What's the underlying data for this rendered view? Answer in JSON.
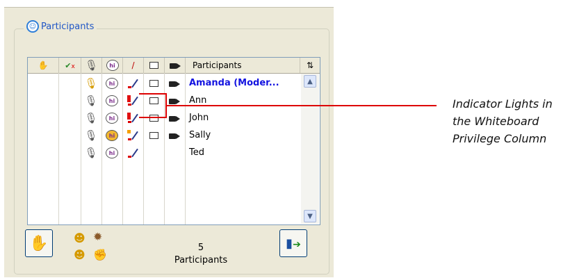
{
  "panel": {
    "title": "Participants"
  },
  "columns": [
    {
      "icon": "raise-hand-icon"
    },
    {
      "icon": "check-x-icon"
    },
    {
      "icon": "microphone-icon"
    },
    {
      "icon": "chat-bubble-icon"
    },
    {
      "icon": "whiteboard-pen-icon"
    },
    {
      "icon": "screen-share-icon"
    },
    {
      "icon": "video-camera-icon"
    },
    {
      "label": "Participants"
    },
    {
      "icon": "sort-icon",
      "glyph": "⇅"
    }
  ],
  "participants": [
    {
      "name": "Amanda (Moder...",
      "moderator": true,
      "mic_active": true,
      "chat_active": false,
      "light": "",
      "video": true
    },
    {
      "name": "Ann",
      "moderator": false,
      "mic_active": false,
      "chat_active": false,
      "light": "red",
      "video": true
    },
    {
      "name": "John",
      "moderator": false,
      "mic_active": false,
      "chat_active": false,
      "light": "red",
      "video": true
    },
    {
      "name": "Sally",
      "moderator": false,
      "mic_active": false,
      "chat_active": true,
      "light": "orange",
      "video": true
    },
    {
      "name": "Ted",
      "moderator": false,
      "mic_active": false,
      "chat_active": false,
      "light": "",
      "video": false
    }
  ],
  "footer": {
    "count": "5",
    "count_label": "Participants"
  },
  "callout": {
    "line1": "Indicator Lights in",
    "line2": "the Whiteboard",
    "line3": "Privilege Column"
  },
  "colors": {
    "moderator": "#1313e0",
    "light_red": "#e01010",
    "light_orange": "#f5a000",
    "callout_line": "#dd0000"
  }
}
